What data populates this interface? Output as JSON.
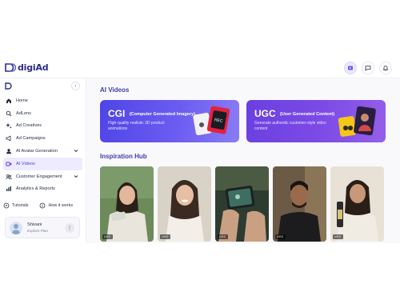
{
  "app": {
    "brand": "digiAd"
  },
  "topbar": {
    "icons": [
      "media-icon",
      "chat-icon",
      "bell-icon"
    ]
  },
  "sidebar": {
    "items": [
      {
        "label": "Home",
        "icon": "home-icon"
      },
      {
        "label": "AdLens",
        "icon": "search-icon"
      },
      {
        "label": "Ad Creatives",
        "icon": "sparkle-icon"
      },
      {
        "label": "Ad Campaigns",
        "icon": "megaphone-icon"
      },
      {
        "label": "AI Avatar Generation",
        "icon": "avatar-icon",
        "expandable": true
      },
      {
        "label": "AI Videos",
        "icon": "video-icon",
        "active": true
      },
      {
        "label": "Customer Engagement",
        "icon": "users-icon",
        "expandable": true
      },
      {
        "label": "Analytics & Reports",
        "icon": "chart-icon"
      }
    ],
    "tutorials_label": "Tutorials",
    "how_label": "How it works",
    "user": {
      "name": "Shivani",
      "plan": "Explore Plan"
    }
  },
  "main": {
    "ai_videos_title": "AI Videos",
    "cards": [
      {
        "title": "CGI",
        "subtitle": "(Computer Generated Imagery)",
        "desc": "High-quality realistic 3D product animations"
      },
      {
        "title": "UGC",
        "subtitle": "(User Generated Content)",
        "desc": "Generate authentic customer-style video content"
      }
    ],
    "inspiration_title": "Inspiration Hub",
    "thumbs": [
      {
        "tag": "UGC"
      },
      {
        "tag": "UGC"
      },
      {
        "tag": "UGC"
      },
      {
        "tag": "UGC"
      },
      {
        "tag": "UGC"
      }
    ]
  },
  "colors": {
    "accent": "#4b3fd8",
    "brand": "#2d2f86",
    "card_cgi": "#5a4ee9",
    "card_ugc": "#7a48e5"
  }
}
